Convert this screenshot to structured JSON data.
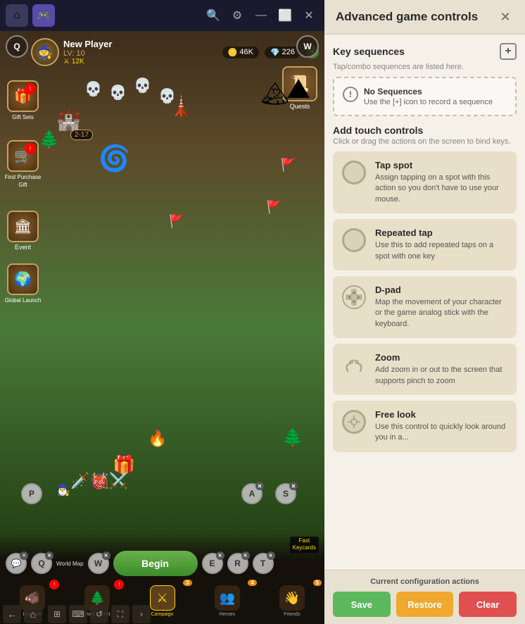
{
  "topbar": {
    "buttons": [
      "⌂",
      "🎮",
      "🔍",
      "⚙",
      "—",
      "⬜",
      "✕"
    ]
  },
  "player": {
    "name": "New Player",
    "level": "LV: 10",
    "gold": "46K",
    "gems": "226",
    "power": "12K"
  },
  "hud": {
    "q_label": "Q",
    "w_label": "W"
  },
  "sidebar_left": [
    {
      "label": "Gift Sets",
      "icon": "🎁",
      "badge": true
    },
    {
      "label": "First Purchase Gift",
      "icon": "🛒",
      "badge": true
    },
    {
      "label": "Event",
      "icon": "🏛",
      "badge": false
    },
    {
      "label": "Global Launch",
      "icon": "🌍",
      "badge": false
    }
  ],
  "battle_badge": "2-17",
  "key_buttons": [
    {
      "key": "P",
      "pos": "p"
    },
    {
      "key": "A",
      "pos": "a"
    },
    {
      "key": "S",
      "pos": "s"
    },
    {
      "key": "Q",
      "pos": "q2"
    },
    {
      "key": "W",
      "pos": "w2"
    },
    {
      "key": "E",
      "pos": "e"
    },
    {
      "key": "R",
      "pos": "r"
    },
    {
      "key": "T",
      "pos": "t"
    }
  ],
  "begin_btn": "Begin",
  "fast_cards": "Fast\nKeycards",
  "nav_tabs": [
    {
      "label": "Roghorn",
      "icon": "🐗",
      "badge": true,
      "active": false,
      "num": null
    },
    {
      "label": "Dark Forest",
      "icon": "🌲",
      "badge": true,
      "num": null,
      "active": false
    },
    {
      "label": "Campaign",
      "icon": "⚔",
      "badge": false,
      "num": "3",
      "active": true
    },
    {
      "label": "Heroes",
      "icon": "👥",
      "badge": false,
      "num": "4",
      "active": false
    },
    {
      "label": "Friends",
      "icon": "👋",
      "badge": false,
      "num": "5",
      "active": false
    }
  ],
  "right_panel": {
    "title": "Advanced game controls",
    "close_label": "✕",
    "key_sequences": {
      "title": "Key sequences",
      "desc": "Tap/combo sequences are listed here.",
      "add_btn": "+",
      "no_sequences": {
        "title": "No Sequences",
        "desc": "Use the [+] icon to record a sequence"
      }
    },
    "touch_controls": {
      "title": "Add touch controls",
      "desc": "Click or drag the actions on the screen to bind keys.",
      "controls": [
        {
          "name": "Tap spot",
          "desc": "Assign tapping on a spot with this action so you don't have to use your mouse.",
          "type": "tap"
        },
        {
          "name": "Repeated tap",
          "desc": "Use this to add repeated taps on a spot with one key",
          "type": "repeated"
        },
        {
          "name": "D-pad",
          "desc": "Map the movement of your character or the game analog stick with the keyboard.",
          "type": "dpad"
        },
        {
          "name": "Zoom",
          "desc": "Add zoom in or out to the screen that supports pinch to zoom",
          "type": "zoom"
        },
        {
          "name": "Free look",
          "desc": "Use this control to quickly look around you in a...",
          "type": "freelook"
        }
      ]
    },
    "footer": {
      "label": "Current configuration actions",
      "save": "Save",
      "restore": "Restore",
      "clear": "Clear"
    }
  }
}
